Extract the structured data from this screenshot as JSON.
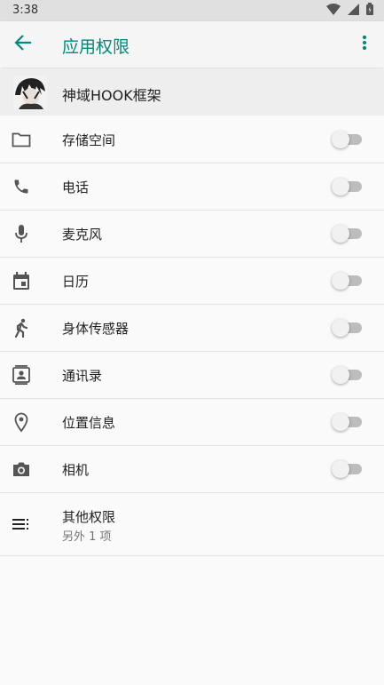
{
  "status_bar": {
    "time": "3:38",
    "icons": [
      "wifi-icon",
      "signal-icon",
      "battery-icon"
    ]
  },
  "toolbar": {
    "title": "应用权限",
    "back_icon": "arrow-back-icon",
    "menu_icon": "more-vert-icon",
    "accent_color": "#00897b"
  },
  "app": {
    "name": "神域HOOK框架",
    "avatar_icon": "app-avatar-icon"
  },
  "permissions": [
    {
      "label": "存储空间",
      "icon": "folder-icon",
      "enabled": false
    },
    {
      "label": "电话",
      "icon": "phone-icon",
      "enabled": false
    },
    {
      "label": "麦克风",
      "icon": "microphone-icon",
      "enabled": false
    },
    {
      "label": "日历",
      "icon": "calendar-icon",
      "enabled": false
    },
    {
      "label": "身体传感器",
      "icon": "walking-person-icon",
      "enabled": false
    },
    {
      "label": "通讯录",
      "icon": "contacts-icon",
      "enabled": false
    },
    {
      "label": "位置信息",
      "icon": "location-pin-icon",
      "enabled": false
    },
    {
      "label": "相机",
      "icon": "camera-icon",
      "enabled": false
    }
  ],
  "other": {
    "label": "其他权限",
    "sublabel": "另外 1 项",
    "icon": "list-icon"
  }
}
